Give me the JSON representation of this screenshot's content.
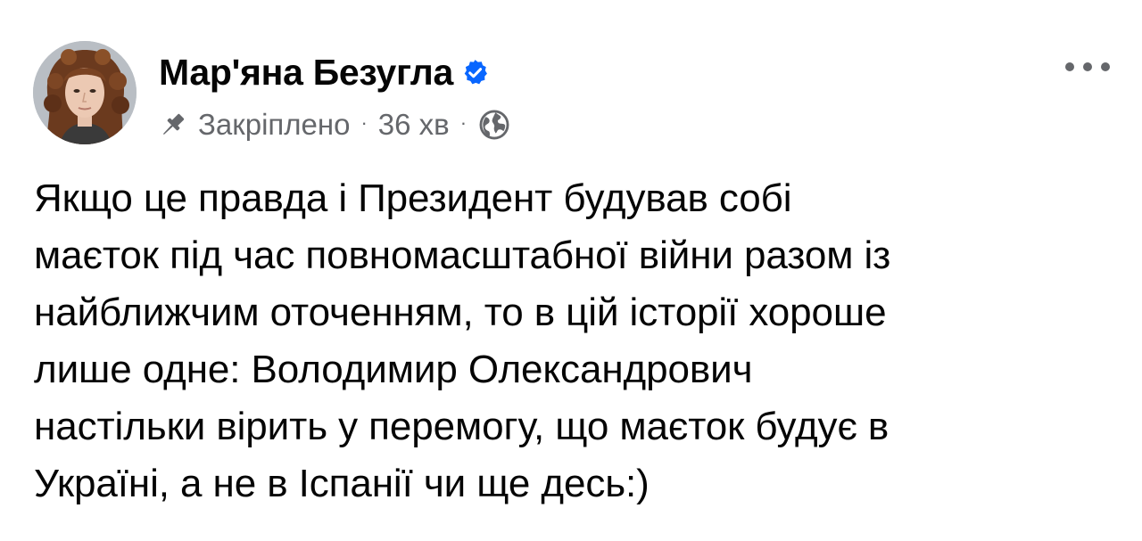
{
  "post": {
    "author": {
      "name": "Мар'яна Безугла",
      "verified": true,
      "avatar_icon": "profile-photo"
    },
    "meta": {
      "pinned_label": "Закріплено",
      "time": "36 хв",
      "separator": "·",
      "audience_icon": "globe-icon"
    },
    "more_icon": "more-options-icon",
    "body_lines": [
      "Якщо це правда і Президент будував собі",
      "маєток під час повномасштабної війни разом із",
      "найближчим оточенням, то в цій історії хороше",
      "лише одне: Володимир Олександрович",
      "настільки вірить у перемогу, що маєток будує в",
      "Україні, а не в Іспанії чи ще десь:)"
    ]
  },
  "colors": {
    "text_primary": "#050505",
    "text_secondary": "#65676b",
    "verified_badge": "#0866ff",
    "background": "#ffffff"
  }
}
